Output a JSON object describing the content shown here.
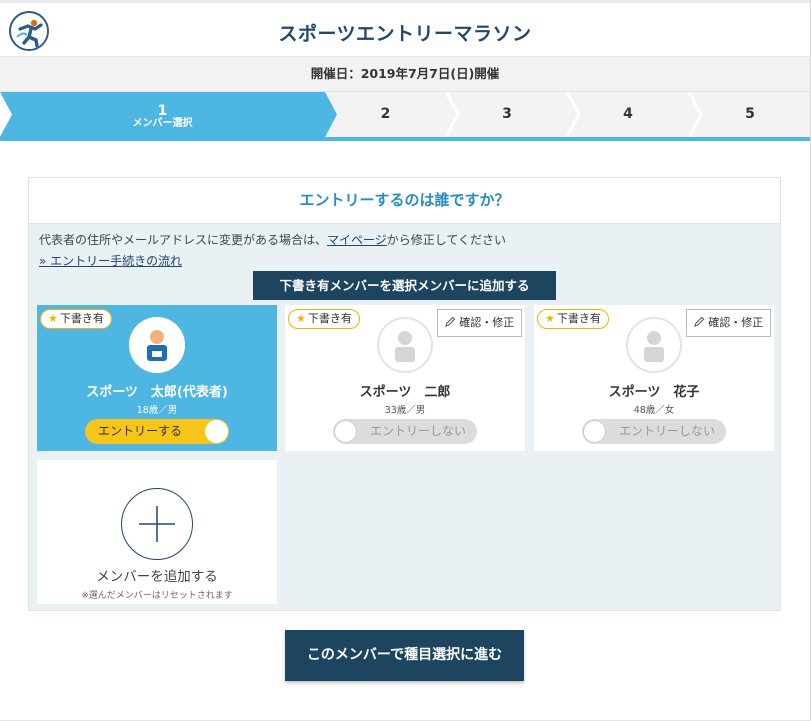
{
  "header": {
    "title": "スポーツエントリーマラソン",
    "event_date": "開催日：2019年7月7日(日)開催"
  },
  "steps": [
    {
      "num": "1",
      "label": "メンバー選択",
      "active": true
    },
    {
      "num": "2"
    },
    {
      "num": "3"
    },
    {
      "num": "4"
    },
    {
      "num": "5"
    }
  ],
  "question": {
    "heading": "エントリーするのは誰ですか？",
    "notice_prefix": "代表者の住所やメールアドレスに変更がある場合は、",
    "notice_link": "マイページ",
    "notice_suffix": "から修正してください",
    "flow_link": "» エントリー手続きの流れ",
    "add_draft_button": "下書き有メンバーを選択メンバーに追加する"
  },
  "members": [
    {
      "badge": "下書き有",
      "name": "スポーツ　太郎(代表者)",
      "info": "18歳／男",
      "toggle": "エントリーする",
      "selected": true
    },
    {
      "badge": "下書き有",
      "edit": "確認・修正",
      "name": "スポーツ　二郎",
      "info": "33歳／男",
      "toggle": "エントリーしない",
      "selected": false
    },
    {
      "badge": "下書き有",
      "edit": "確認・修正",
      "name": "スポーツ　花子",
      "info": "48歳／女",
      "toggle": "エントリーしない",
      "selected": false
    }
  ],
  "add_member": {
    "label": "メンバーを追加する",
    "note": "※選んだメンバーはリセットされます"
  },
  "proceed_button": "このメンバーで種目選択に進む",
  "colors": {
    "accent": "#4eb6e3",
    "navy": "#1d4560",
    "toggle_on": "#f6c51a",
    "badge_border": "#f0b400"
  }
}
